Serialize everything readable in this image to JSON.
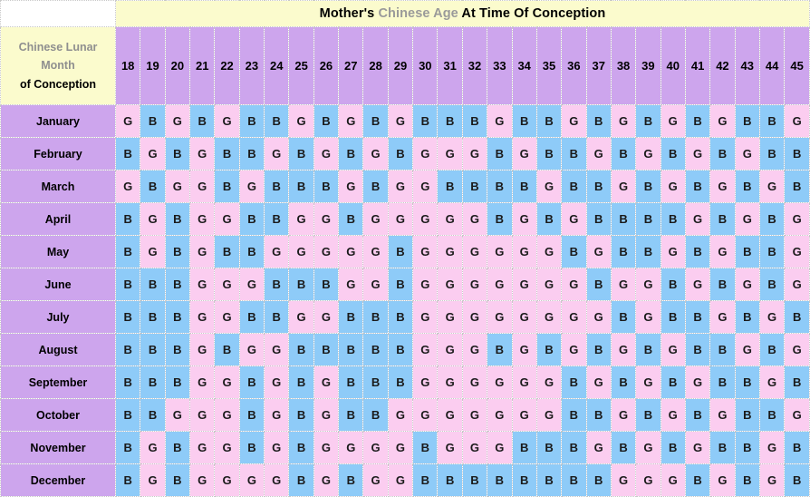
{
  "header": {
    "title_prefix": "Mother's ",
    "title_highlight": "Chinese Age",
    "title_suffix": " At Time Of Conception",
    "row_label_line1": "Chinese Lunar",
    "row_label_line2": "Month",
    "row_label_line3": "of Conception"
  },
  "colors": {
    "title_background": "#fbfbcd",
    "header_purple": "#cda5ed",
    "girl_pink": "#fbcdf0",
    "boy_blue": "#8ecbf8",
    "gray_text": "#9a9a9a",
    "grid_line": "#c8c8c8"
  },
  "legend": {
    "girl_code": "G",
    "boy_code": "B"
  },
  "chart_data": {
    "type": "heatmap",
    "title": "Mother's Chinese Age At Time Of Conception",
    "xlabel": "Mother's Chinese Age At Time Of Conception",
    "ylabel": "Chinese Lunar Month of Conception",
    "categories": [
      "18",
      "19",
      "20",
      "21",
      "22",
      "23",
      "24",
      "25",
      "26",
      "27",
      "28",
      "29",
      "30",
      "31",
      "32",
      "33",
      "34",
      "35",
      "36",
      "37",
      "38",
      "39",
      "40",
      "41",
      "42",
      "43",
      "44",
      "45"
    ],
    "rows": [
      {
        "label": "January",
        "values": [
          "G",
          "B",
          "G",
          "B",
          "G",
          "B",
          "B",
          "G",
          "B",
          "G",
          "B",
          "G",
          "B",
          "B",
          "B",
          "G",
          "B",
          "B",
          "G",
          "B",
          "G",
          "B",
          "G",
          "B",
          "G",
          "B",
          "B",
          "G"
        ]
      },
      {
        "label": "February",
        "values": [
          "B",
          "G",
          "B",
          "G",
          "B",
          "B",
          "G",
          "B",
          "G",
          "B",
          "G",
          "B",
          "G",
          "G",
          "G",
          "B",
          "G",
          "B",
          "B",
          "G",
          "B",
          "G",
          "B",
          "G",
          "B",
          "G",
          "B",
          "B"
        ]
      },
      {
        "label": "March",
        "values": [
          "G",
          "B",
          "G",
          "G",
          "B",
          "G",
          "B",
          "B",
          "B",
          "G",
          "B",
          "G",
          "G",
          "B",
          "B",
          "B",
          "B",
          "G",
          "B",
          "B",
          "G",
          "B",
          "G",
          "B",
          "G",
          "B",
          "G",
          "B"
        ]
      },
      {
        "label": "April",
        "values": [
          "B",
          "G",
          "B",
          "G",
          "G",
          "B",
          "B",
          "G",
          "G",
          "B",
          "G",
          "G",
          "G",
          "G",
          "G",
          "B",
          "G",
          "B",
          "G",
          "B",
          "B",
          "B",
          "B",
          "G",
          "B",
          "G",
          "B",
          "G"
        ]
      },
      {
        "label": "May",
        "values": [
          "B",
          "G",
          "B",
          "G",
          "B",
          "B",
          "G",
          "G",
          "G",
          "G",
          "G",
          "B",
          "G",
          "G",
          "G",
          "G",
          "G",
          "G",
          "B",
          "G",
          "B",
          "B",
          "G",
          "B",
          "G",
          "B",
          "B",
          "G"
        ]
      },
      {
        "label": "June",
        "values": [
          "B",
          "B",
          "B",
          "G",
          "G",
          "G",
          "B",
          "B",
          "B",
          "G",
          "G",
          "B",
          "G",
          "G",
          "G",
          "G",
          "G",
          "G",
          "G",
          "B",
          "G",
          "G",
          "B",
          "G",
          "B",
          "G",
          "B",
          "G"
        ]
      },
      {
        "label": "July",
        "values": [
          "B",
          "B",
          "B",
          "G",
          "G",
          "B",
          "B",
          "G",
          "G",
          "B",
          "B",
          "B",
          "G",
          "G",
          "G",
          "G",
          "G",
          "G",
          "G",
          "G",
          "B",
          "G",
          "B",
          "B",
          "G",
          "B",
          "G",
          "B"
        ]
      },
      {
        "label": "August",
        "values": [
          "B",
          "B",
          "B",
          "G",
          "B",
          "G",
          "G",
          "B",
          "B",
          "B",
          "B",
          "B",
          "G",
          "G",
          "G",
          "B",
          "G",
          "B",
          "G",
          "B",
          "G",
          "B",
          "G",
          "B",
          "B",
          "G",
          "B",
          "G"
        ]
      },
      {
        "label": "September",
        "values": [
          "B",
          "B",
          "B",
          "G",
          "G",
          "B",
          "G",
          "B",
          "G",
          "B",
          "B",
          "B",
          "G",
          "G",
          "G",
          "G",
          "G",
          "G",
          "B",
          "G",
          "B",
          "G",
          "B",
          "G",
          "B",
          "B",
          "G",
          "B"
        ]
      },
      {
        "label": "October",
        "values": [
          "B",
          "B",
          "G",
          "G",
          "G",
          "B",
          "G",
          "B",
          "G",
          "B",
          "B",
          "G",
          "G",
          "G",
          "G",
          "G",
          "G",
          "G",
          "B",
          "B",
          "G",
          "B",
          "G",
          "B",
          "G",
          "B",
          "B",
          "G"
        ]
      },
      {
        "label": "November",
        "values": [
          "B",
          "G",
          "B",
          "G",
          "G",
          "B",
          "G",
          "B",
          "G",
          "G",
          "G",
          "G",
          "B",
          "G",
          "G",
          "G",
          "B",
          "B",
          "B",
          "G",
          "B",
          "G",
          "B",
          "G",
          "B",
          "B",
          "G",
          "B"
        ]
      },
      {
        "label": "December",
        "values": [
          "B",
          "G",
          "B",
          "G",
          "G",
          "G",
          "G",
          "B",
          "G",
          "B",
          "G",
          "G",
          "B",
          "B",
          "B",
          "B",
          "B",
          "B",
          "B",
          "B",
          "G",
          "G",
          "G",
          "B",
          "G",
          "B",
          "G",
          "B"
        ]
      }
    ]
  }
}
